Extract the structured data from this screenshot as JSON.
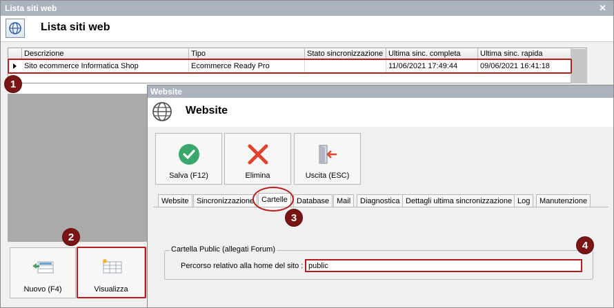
{
  "back_window": {
    "title": "Lista siti web",
    "close_glyph": "✕",
    "heading": "Lista siti web",
    "icon": "globe-icon"
  },
  "grid": {
    "columns": [
      "Descrizione",
      "Tipo",
      "Stato sincronizzazione",
      "Ultima sinc. completa",
      "Ultima sinc. rapida"
    ],
    "rows": [
      {
        "descrizione": "Sito ecommerce Informatica Shop",
        "tipo": "Ecommerce Ready Pro",
        "stato": "",
        "ultima_completa": "11/06/2021 17:49:44",
        "ultima_rapida": "09/06/2021 16:41:18"
      }
    ]
  },
  "back_buttons": {
    "nuovo": "Nuovo (F4)",
    "visualizza": "Visualizza"
  },
  "front_window": {
    "title": "Website",
    "heading": "Website",
    "icon": "globe-icon"
  },
  "toolbar": {
    "save": "Salva (F12)",
    "delete": "Elimina",
    "exit": "Uscita (ESC)"
  },
  "tabs": [
    "Website",
    "Sincronizzazione",
    "Cartelle",
    "Database",
    "Mail",
    "Diagnostica",
    "Dettagli ultima sincronizzazione",
    "Log",
    "Manutenzione"
  ],
  "active_tab": "Cartelle",
  "group": {
    "legend": "Cartella Public (allegati Forum)",
    "field_label": "Percorso relativo alla home del sito :",
    "field_value": "public"
  },
  "markers": [
    "1",
    "2",
    "3",
    "4"
  ],
  "colors": {
    "accent_red": "#b71c1c",
    "badge": "#7a1515",
    "save_green": "#3aa86b",
    "delete_red": "#e0442f",
    "title_bar": "#aab3be"
  }
}
